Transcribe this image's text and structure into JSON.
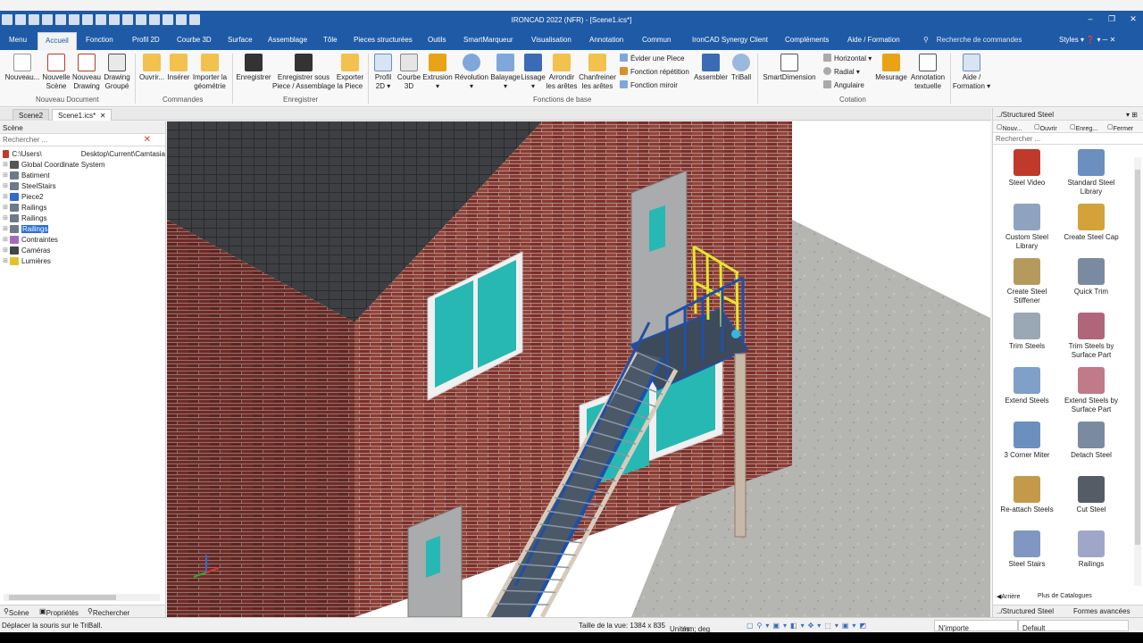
{
  "window": {
    "title": "IRONCAD 2022 (NFR) - [Scene1.ics*]",
    "controls": {
      "minimize": "–",
      "restore": "❐",
      "close": "✕"
    }
  },
  "menu_tabs": [
    {
      "label": "Menu"
    },
    {
      "label": "Accueil"
    },
    {
      "label": "Fonction"
    },
    {
      "label": "Profil 2D"
    },
    {
      "label": "Courbe 3D"
    },
    {
      "label": "Surface"
    },
    {
      "label": "Assemblage"
    },
    {
      "label": "Tôle"
    },
    {
      "label": "Pieces structurées"
    },
    {
      "label": "Outils"
    },
    {
      "label": "SmartMarqueur"
    },
    {
      "label": "Visualisation"
    },
    {
      "label": "Annotation"
    },
    {
      "label": "Commun"
    },
    {
      "label": "IronCAD Synergy Client"
    },
    {
      "label": "Compléments"
    },
    {
      "label": "Aide / Formation"
    }
  ],
  "active_tab": "Accueil",
  "command_search": "Recherche de commandes",
  "styles_label": "Styles",
  "ribbon": {
    "buttons": [
      {
        "label1": "Nouveau...",
        "label2": ""
      },
      {
        "label1": "Nouvelle",
        "label2": "Scène"
      },
      {
        "label1": "Nouveau",
        "label2": "Drawing"
      },
      {
        "label1": "Drawing",
        "label2": "Groupé"
      },
      {
        "label1": "Ouvrir...",
        "label2": ""
      },
      {
        "label1": "Insérer",
        "label2": ""
      },
      {
        "label1": "Importer la",
        "label2": "géométrie"
      },
      {
        "label1": "Enregistrer",
        "label2": ""
      },
      {
        "label1": "Enregistrer sous",
        "label2": "Piece / Assemblage"
      },
      {
        "label1": "Exporter",
        "label2": "la Piece"
      },
      {
        "label1": "Profil",
        "label2": "2D ▾"
      },
      {
        "label1": "Courbe",
        "label2": "3D"
      },
      {
        "label1": "Extrusion",
        "label2": "▾"
      },
      {
        "label1": "Révolution",
        "label2": "▾"
      },
      {
        "label1": "Balayage",
        "label2": "▾"
      },
      {
        "label1": "Lissage",
        "label2": "▾"
      },
      {
        "label1": "Arrondir",
        "label2": "les arêtes"
      },
      {
        "label1": "Chanfreiner",
        "label2": "les arêtes"
      },
      {
        "label1": "Assembler",
        "label2": ""
      },
      {
        "label1": "TriBall",
        "label2": ""
      },
      {
        "label1": "SmartDimension",
        "label2": ""
      },
      {
        "label1": "Mesurage",
        "label2": ""
      },
      {
        "label1": "Annotation",
        "label2": "textuelle"
      },
      {
        "label1": "Aide /",
        "label2": "Formation ▾"
      }
    ],
    "small_buttons": [
      {
        "label": "Évider une Piece"
      },
      {
        "label": "Fonction répétition"
      },
      {
        "label": "Fonction miroir"
      },
      {
        "label": "Horizontal ▾"
      },
      {
        "label": "Radial ▾"
      },
      {
        "label": "Angulaire"
      }
    ],
    "groups": [
      "Nouveau Document",
      "Commandes",
      "Enregistrer",
      "Fonctions de base",
      "Cotation"
    ]
  },
  "doc_tabs": [
    {
      "label": "Scene2"
    },
    {
      "label": "Scene1.ics*"
    }
  ],
  "doc_tab_close": "✕",
  "scene_panel": {
    "title": "Scène",
    "search_placeholder": "Rechercher ...",
    "root": "C:\\Users\\",
    "root_path": "Desktop\\Current\\Camtasia",
    "items": [
      {
        "label": "Global Coordinate System"
      },
      {
        "label": "Batiment"
      },
      {
        "label": "SteelStairs"
      },
      {
        "label": "Piece2"
      },
      {
        "label": "Railings"
      },
      {
        "label": "Railings"
      },
      {
        "label": "Railings"
      },
      {
        "label": "Contraintes"
      },
      {
        "label": "Caméras"
      },
      {
        "label": "Lumières"
      }
    ],
    "selected_index": 6,
    "bottom_tabs": [
      "Scène",
      "Propriétés",
      "Rechercher"
    ]
  },
  "catalog": {
    "title": "../Structured Steel",
    "tools": [
      "Nouv...",
      "Ouvrir",
      "Enreg...",
      "Fermer"
    ],
    "search_placeholder": "Rechercher ...",
    "items": [
      {
        "label": "Steel Video",
        "icon": "video-icon"
      },
      {
        "label": "Standard Steel Library",
        "icon": "steel-library-icon"
      },
      {
        "label": "Custom Steel Library",
        "icon": "custom-library-icon"
      },
      {
        "label": "Create Steel Cap",
        "icon": "steel-cap-icon"
      },
      {
        "label": "Create Steel Stiffener",
        "icon": "stiffener-icon"
      },
      {
        "label": "Quick Trim",
        "icon": "quick-trim-icon"
      },
      {
        "label": "Trim Steels",
        "icon": "trim-steels-icon"
      },
      {
        "label": "Trim Steels by Surface Part",
        "icon": "trim-surface-icon"
      },
      {
        "label": "Extend Steels",
        "icon": "extend-steels-icon"
      },
      {
        "label": "Extend Steels by Surface Part",
        "icon": "extend-surface-icon"
      },
      {
        "label": "3 Corner Miter",
        "icon": "corner-miter-icon"
      },
      {
        "label": "Detach Steel",
        "icon": "detach-steel-icon"
      },
      {
        "label": "Re-attach Steels",
        "icon": "reattach-icon"
      },
      {
        "label": "Cut Steel",
        "icon": "cut-steel-icon"
      },
      {
        "label": "Steel Stairs",
        "icon": "stairs-icon"
      },
      {
        "label": "Railings",
        "icon": "railings-icon"
      }
    ],
    "nav_back": "Arrière",
    "nav_more": "Plus de Catalogues",
    "bottom_tabs": [
      "../Structured Steel",
      "Formes avancées"
    ]
  },
  "status": {
    "hint": "Déplacer la souris sur le TriBall.",
    "view_size": "Taille de la vue: 1384 x 835",
    "units_label": "Unités:",
    "units_value": "mm; deg",
    "filter": "N'importe",
    "style": "Default"
  },
  "colors": {
    "accent": "#1f5aa6",
    "brick": "#8a3a33",
    "glass": "#27b8b4",
    "stair_blue": "#1f4fa6",
    "railing_yellow": "#e6e62a"
  }
}
